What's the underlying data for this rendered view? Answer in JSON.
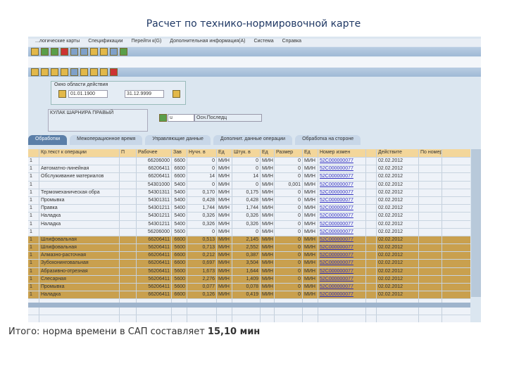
{
  "slide": {
    "title": "Расчет по технико-нормировочной карте",
    "total_prefix": "Итого: норма времени в САП составляет ",
    "total_value": "15,10 мин"
  },
  "menu": [
    "...логические карты",
    "Спецификации",
    "Перейти к(G)",
    "Дополнительная информация(A)",
    "Система",
    "Справка"
  ],
  "header": {
    "validity_label": "Окно области действия",
    "date_from": "01.01.1900",
    "date_to": "31.12.9999",
    "material": "КУЛАК ШАРНИРА ПРАВЫЙ",
    "field_value": "u",
    "field_text": "Осн.Последц"
  },
  "tabs": [
    "Обработки",
    "Межоперационное время",
    "Управляющие данные",
    "Дополнит. данные операции",
    "Обработка на стороне"
  ],
  "columns": [
    "",
    "Кр.текст к операции",
    "П",
    "Рабочее",
    "Зав",
    "Нучн. в",
    "Ед",
    "Штук. в",
    "Ед",
    "Размер",
    "Ед",
    "Номер измен",
    "",
    "Действите",
    "По номер из"
  ],
  "rows": [
    [
      "1",
      "",
      "",
      "66206000",
      "6600",
      "0",
      "МИН",
      "0",
      "МИН",
      "0",
      "МИН",
      "52C000000077",
      "",
      "02.02.2012",
      ""
    ],
    [
      "1",
      "Автоматно-линейная",
      "",
      "66206411",
      "6600",
      "0",
      "МИН",
      "0",
      "МИН",
      "0",
      "МИН",
      "52C000000077",
      "",
      "02.02.2012",
      ""
    ],
    [
      "1",
      "Обслуживание материалов",
      "",
      "66206411",
      "6600",
      "14",
      "МИН",
      "14",
      "МИН",
      "0",
      "МИН",
      "52C000000077",
      "",
      "02.02.2012",
      ""
    ],
    [
      "1",
      "",
      "",
      "54301000",
      "5400",
      "0",
      "МИН",
      "0",
      "МИН",
      "0,001",
      "МИН",
      "52C000000077",
      "",
      "02.02.2012",
      ""
    ],
    [
      "1",
      "Термомеханическая обра",
      "",
      "54301311",
      "5400",
      "0,170",
      "МИН",
      "0,175",
      "МИН",
      "0",
      "МИН",
      "52C000000077",
      "",
      "02.02.2012",
      ""
    ],
    [
      "1",
      "Промывка",
      "",
      "54301311",
      "5400",
      "0,428",
      "МИН",
      "0,428",
      "МИН",
      "0",
      "МИН",
      "52C000000077",
      "",
      "02.02.2012",
      ""
    ],
    [
      "1",
      "Правка",
      "",
      "54301211",
      "5400",
      "1,744",
      "МИН",
      "1,744",
      "МИН",
      "0",
      "МИН",
      "52C000000077",
      "",
      "02.02.2012",
      ""
    ],
    [
      "1",
      "Наладка",
      "",
      "54301211",
      "5400",
      "0,326",
      "МИН",
      "0,326",
      "МИН",
      "0",
      "МИН",
      "52C000000077",
      "",
      "02.02.2012",
      ""
    ],
    [
      "1",
      "Наладка",
      "",
      "54301211",
      "5400",
      "0,326",
      "МИН",
      "0,326",
      "МИН",
      "0",
      "МИН",
      "52C000000077",
      "",
      "02.02.2012",
      ""
    ],
    [
      "1",
      "",
      "",
      "56206000",
      "5600",
      "0",
      "МИН",
      "0",
      "МИН",
      "0",
      "МИН",
      "52C000000077",
      "",
      "02.02.2012",
      ""
    ],
    [
      "1",
      "Шлифовальная",
      "",
      "66206411",
      "6600",
      "0,513",
      "МИН",
      "2,145",
      "МИН",
      "0",
      "МИН",
      "52C000000077",
      "",
      "02.02.2012",
      ""
    ],
    [
      "1",
      "Шлифовальная",
      "",
      "56206411",
      "5600",
      "0,713",
      "МИН",
      "2,552",
      "МИН",
      "0",
      "МИН",
      "52C000000077",
      "",
      "02.02.2012",
      ""
    ],
    [
      "1",
      "Алмазно-расточная",
      "",
      "66206411",
      "6600",
      "0,212",
      "МИН",
      "0,387",
      "МИН",
      "0",
      "МИН",
      "52C000000077",
      "",
      "02.02.2012",
      ""
    ],
    [
      "1",
      "Зубохонинговальная",
      "",
      "66206411",
      "6600",
      "0,697",
      "МИН",
      "3,504",
      "МИН",
      "0",
      "МИН",
      "52C000000077",
      "",
      "02.02.2012",
      ""
    ],
    [
      "1",
      "Абразивно-отрезная",
      "",
      "56206411",
      "5600",
      "1,673",
      "МИН",
      "1,644",
      "МИН",
      "0",
      "МИН",
      "52C000000077",
      "",
      "02.02.2012",
      ""
    ],
    [
      "1",
      "Слесарная",
      "",
      "56206411",
      "5600",
      "2,276",
      "МИН",
      "1,409",
      "МИН",
      "0",
      "МИН",
      "52C000000077",
      "",
      "02.02.2012",
      ""
    ],
    [
      "1",
      "Промывка",
      "",
      "56206411",
      "5600",
      "0,077",
      "МИН",
      "0,078",
      "МИН",
      "0",
      "МИН",
      "52C000000077",
      "",
      "02.02.2012",
      ""
    ],
    [
      "1",
      "Наладка",
      "",
      "66206411",
      "6600",
      "0,126",
      "МИН",
      "0,419",
      "МИН",
      "0",
      "МИН",
      "52C000000077",
      "",
      "02.02.2012",
      ""
    ]
  ],
  "selected_from": 10,
  "colors": {
    "selected": "#c9a04e",
    "header": "#f3d69a",
    "tabActive": "#5b7fa8"
  }
}
